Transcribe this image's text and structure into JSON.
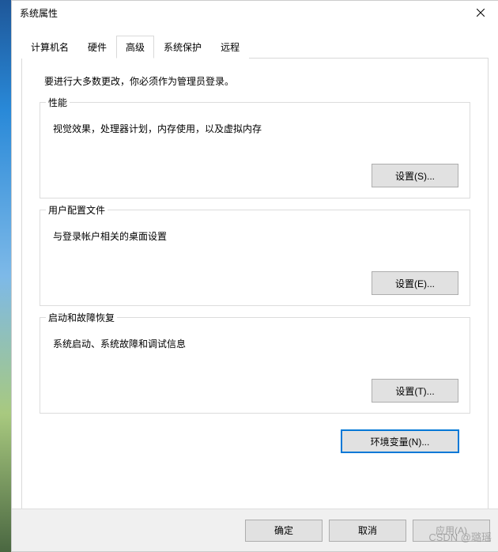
{
  "window": {
    "title": "系统属性"
  },
  "tabs": {
    "items": [
      {
        "label": "计算机名"
      },
      {
        "label": "硬件"
      },
      {
        "label": "高级"
      },
      {
        "label": "系统保护"
      },
      {
        "label": "远程"
      }
    ],
    "activeIndex": 2
  },
  "advanced": {
    "admin_note": "要进行大多数更改，你必须作为管理员登录。",
    "perf": {
      "title": "性能",
      "desc": "视觉效果，处理器计划，内存使用，以及虚拟内存",
      "button": "设置(S)..."
    },
    "user_profiles": {
      "title": "用户配置文件",
      "desc": "与登录帐户相关的桌面设置",
      "button": "设置(E)..."
    },
    "startup": {
      "title": "启动和故障恢复",
      "desc": "系统启动、系统故障和调试信息",
      "button": "设置(T)..."
    },
    "env_button": "环境变量(N)..."
  },
  "footer": {
    "ok": "确定",
    "cancel": "取消",
    "apply": "应用(A)"
  },
  "watermark": "CSDN @璐瑶"
}
